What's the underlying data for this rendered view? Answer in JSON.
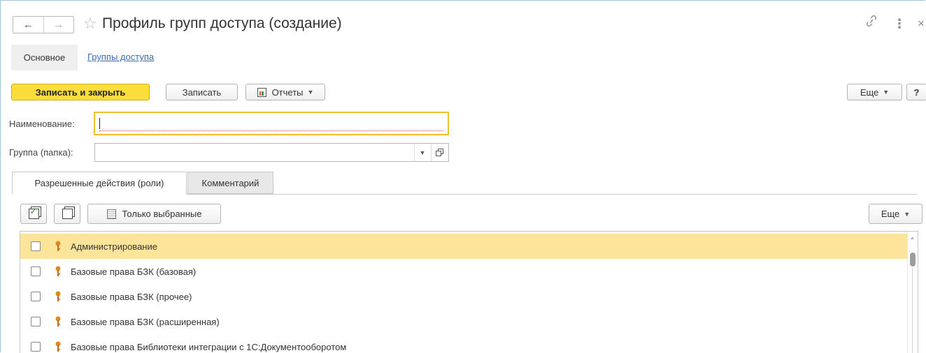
{
  "window": {
    "title": "Профиль групп доступа (создание)",
    "back_glyph": "←",
    "forward_glyph": "→",
    "star_glyph": "☆",
    "link_glyph": "🔗",
    "more_glyph": "⋮",
    "close_glyph": "×"
  },
  "section_tabs": [
    {
      "label": "Основное",
      "active": true
    },
    {
      "label": "Группы доступа",
      "active": false
    }
  ],
  "commands": {
    "save_close": "Записать и закрыть",
    "save": "Записать",
    "reports": "Отчеты",
    "more": "Еще",
    "help": "?"
  },
  "fields": {
    "name_label": "Наименование:",
    "name_value": "",
    "group_label": "Группа (папка):",
    "group_value": ""
  },
  "page_tabs": [
    {
      "label": "Разрешенные действия (роли)",
      "active": true
    },
    {
      "label": "Комментарий",
      "active": false
    }
  ],
  "table_toolbar": {
    "only_selected": "Только выбранные",
    "more": "Еще"
  },
  "roles": [
    {
      "label": "Администрирование",
      "checked": false,
      "selected": true
    },
    {
      "label": "Базовые права БЗК (базовая)",
      "checked": false,
      "selected": false
    },
    {
      "label": "Базовые права БЗК (прочее)",
      "checked": false,
      "selected": false
    },
    {
      "label": "Базовые права БЗК (расширенная)",
      "checked": false,
      "selected": false
    },
    {
      "label": "Базовые права Библиотеки интеграции с 1С:Документооборотом",
      "checked": false,
      "selected": false
    }
  ],
  "colors": {
    "primary_button": "#fcdd3b",
    "selected_row": "#fce59a",
    "link": "#3c6cb4",
    "focus_border": "#f0c02c",
    "role_key_icon": "#e08a1e"
  }
}
